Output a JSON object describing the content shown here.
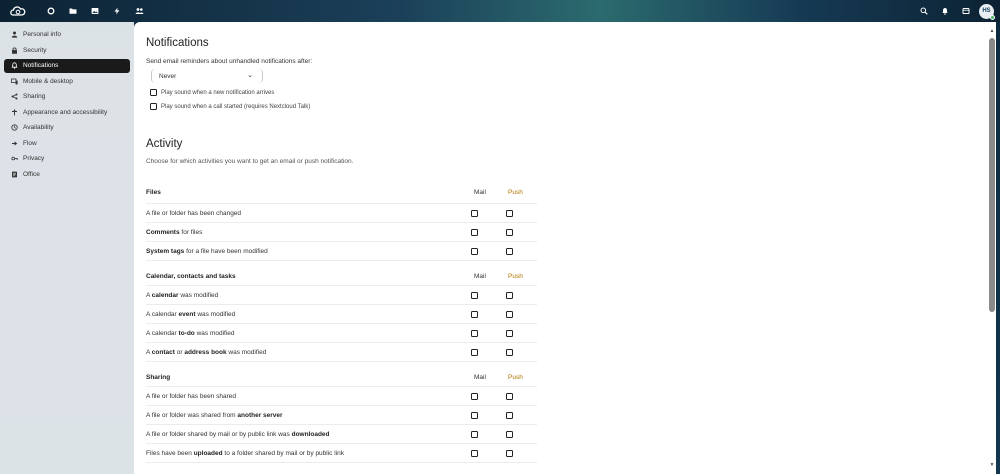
{
  "header": {
    "apps": [
      {
        "name": "dashboard-app",
        "icon": "circle-icon"
      },
      {
        "name": "files-app",
        "icon": "folder-icon"
      },
      {
        "name": "photos-app",
        "icon": "image-icon"
      },
      {
        "name": "activity-app",
        "icon": "bolt-icon"
      },
      {
        "name": "contacts-app",
        "icon": "people-icon"
      }
    ],
    "right_icons": [
      "search-icon",
      "notifications-icon",
      "contacts-menu-icon"
    ],
    "avatar_initials": "HS"
  },
  "sidebar": {
    "items": [
      {
        "label": "Personal info",
        "icon": "person-icon",
        "active": false
      },
      {
        "label": "Security",
        "icon": "lock-icon",
        "active": false
      },
      {
        "label": "Notifications",
        "icon": "bell-icon",
        "active": true
      },
      {
        "label": "Mobile & desktop",
        "icon": "phone-icon",
        "active": false
      },
      {
        "label": "Sharing",
        "icon": "share-icon",
        "active": false
      },
      {
        "label": "Appearance and accessibility",
        "icon": "palette-icon",
        "active": false
      },
      {
        "label": "Availability",
        "icon": "clock-icon",
        "active": false
      },
      {
        "label": "Flow",
        "icon": "flow-icon",
        "active": false
      },
      {
        "label": "Privacy",
        "icon": "key-icon",
        "active": false
      },
      {
        "label": "Office",
        "icon": "document-icon",
        "active": false
      }
    ]
  },
  "notifications": {
    "title": "Notifications",
    "reminder_label": "Send email reminders about unhandled notifications after:",
    "reminder_value": "Never",
    "sound_notification": "Play sound when a new notification arrives",
    "sound_call": "Play sound when a call started (requires Nextcloud Talk)"
  },
  "activity": {
    "title": "Activity",
    "description": "Choose for which activities you want to get an email or push notification.",
    "col_mail": "Mail",
    "col_push": "Push",
    "groups": [
      {
        "title": "Files",
        "rows": [
          [
            {
              "t": "A file or folder has been changed",
              "b": false
            }
          ],
          [
            {
              "t": "Comments",
              "b": true
            },
            {
              "t": " for files",
              "b": false
            }
          ],
          [
            {
              "t": "System tags",
              "b": true
            },
            {
              "t": " for a file have been modified",
              "b": false
            }
          ]
        ]
      },
      {
        "title": "Calendar, contacts and tasks",
        "rows": [
          [
            {
              "t": "A ",
              "b": false
            },
            {
              "t": "calendar",
              "b": true
            },
            {
              "t": " was modified",
              "b": false
            }
          ],
          [
            {
              "t": "A calendar ",
              "b": false
            },
            {
              "t": "event",
              "b": true
            },
            {
              "t": " was modified",
              "b": false
            }
          ],
          [
            {
              "t": "A calendar ",
              "b": false
            },
            {
              "t": "to-do",
              "b": true
            },
            {
              "t": " was modified",
              "b": false
            }
          ],
          [
            {
              "t": "A ",
              "b": false
            },
            {
              "t": "contact",
              "b": true
            },
            {
              "t": " or ",
              "b": false
            },
            {
              "t": "address book",
              "b": true
            },
            {
              "t": " was modified",
              "b": false
            }
          ]
        ]
      },
      {
        "title": "Sharing",
        "rows": [
          [
            {
              "t": "A file or folder has been shared",
              "b": false
            }
          ],
          [
            {
              "t": "A file or folder was shared from ",
              "b": false
            },
            {
              "t": "another server",
              "b": true
            }
          ],
          [
            {
              "t": "A file or folder shared by mail or by public link was ",
              "b": false
            },
            {
              "t": "downloaded",
              "b": true
            }
          ],
          [
            {
              "t": "Files have been ",
              "b": false
            },
            {
              "t": "uploaded",
              "b": true
            },
            {
              "t": " to a folder shared by mail or by public link",
              "b": false
            }
          ]
        ]
      }
    ]
  }
}
